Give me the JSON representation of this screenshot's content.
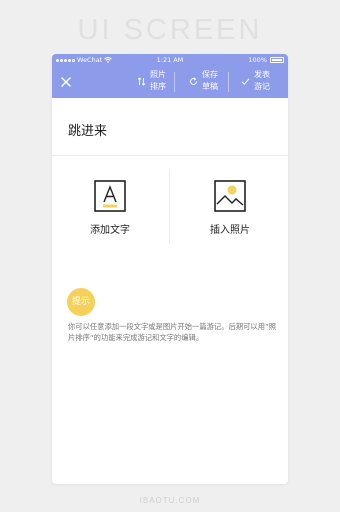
{
  "watermark": {
    "top": "UI SCREEN",
    "bottom": "IBAOTU.COM"
  },
  "statusbar": {
    "carrier": "WeChat",
    "time": "1:21 AM",
    "battery": "100%"
  },
  "navbar": {
    "close_icon": "close-icon",
    "actions": [
      {
        "label": "照片排序",
        "icon": "sort-icon"
      },
      {
        "label": "保存草稿",
        "icon": "refresh-icon"
      },
      {
        "label": "发表游记",
        "icon": "check-icon"
      }
    ]
  },
  "page_title": "跳进来",
  "options": [
    {
      "label": "添加文字",
      "icon": "text-icon"
    },
    {
      "label": "插入照片",
      "icon": "image-icon"
    }
  ],
  "tip": {
    "badge": "提示",
    "text": "你可以任意添加一段文字或是图片开始一篇游记。后期可以用”照片排序“的功能来完成游记和文字的编辑。"
  },
  "colors": {
    "accent": "#8c9bea",
    "tip_badge": "#f5d15c",
    "icon_yellow": "#f5d15c"
  }
}
